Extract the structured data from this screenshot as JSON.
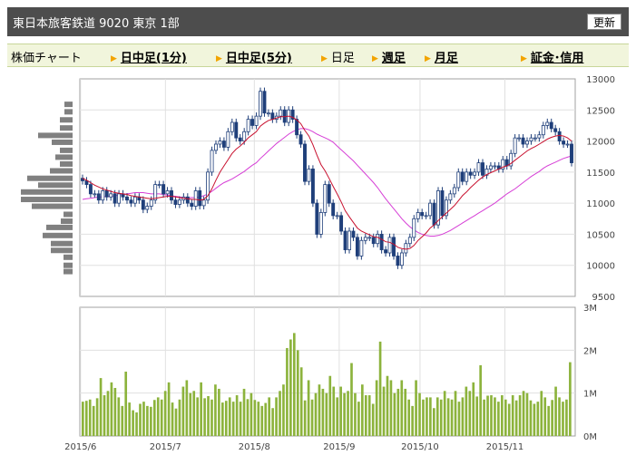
{
  "header": {
    "title": "東日本旅客鉄道  9020  東京 1部",
    "refresh_label": "更新"
  },
  "nav": {
    "chart_label": "株価チャート",
    "intraday1_label": "日中足(1分)",
    "intraday5_label": "日中足(5分)",
    "daily_label": "日足",
    "weekly_label": "週足",
    "monthly_label": "月足",
    "margin_label": "証金･信用"
  },
  "colors": {
    "up_candle": "#ffffff",
    "down_candle": "#1f3f7a",
    "ma_short": "#c8102e",
    "ma_long": "#d63fd6",
    "volume": "#8cb33c",
    "price_hist": "#808080"
  },
  "chart_data": {
    "type": "candlestick",
    "price_axis": {
      "min": 9500,
      "max": 13000,
      "ticks": [
        "13000",
        "12500",
        "12000",
        "11500",
        "11000",
        "10500",
        "10000",
        "9500"
      ]
    },
    "volume_axis": {
      "min": 0,
      "max": 3000000,
      "ticks": [
        "3M",
        "2M",
        "1M",
        "0M"
      ]
    },
    "x_labels": [
      "2015/6",
      "2015/7",
      "2015/8",
      "2015/9",
      "2015/10",
      "2015/11"
    ],
    "month_start_index": [
      0,
      21,
      43,
      64,
      84,
      105
    ],
    "close": [
      11360,
      11300,
      11150,
      11150,
      11050,
      11200,
      11100,
      11150,
      11000,
      11150,
      11100,
      11050,
      11000,
      11100,
      11050,
      10900,
      10950,
      11050,
      11300,
      11300,
      11150,
      11200,
      11050,
      10980,
      11050,
      11100,
      11000,
      10950,
      11200,
      10960,
      11050,
      11500,
      11850,
      11950,
      12000,
      11900,
      12150,
      12300,
      12050,
      12000,
      12150,
      12350,
      12250,
      12400,
      12800,
      12450,
      12450,
      12350,
      12400,
      12500,
      12300,
      12500,
      12350,
      12100,
      11950,
      11350,
      11550,
      11000,
      10500,
      10850,
      11300,
      11000,
      10800,
      10800,
      10550,
      10250,
      10550,
      10450,
      10150,
      10400,
      10450,
      10450,
      10350,
      10500,
      10250,
      10200,
      10450,
      10150,
      10000,
      10200,
      10350,
      10450,
      10750,
      10850,
      10800,
      10800,
      11000,
      10650,
      11200,
      10800,
      11050,
      11150,
      11250,
      11500,
      11350,
      11500,
      11450,
      11500,
      11650,
      11450,
      11550,
      11600,
      11600,
      11550,
      11700,
      11600,
      11800,
      12050,
      12050,
      11950,
      12000,
      12050,
      12050,
      12100,
      12250,
      12300,
      12200,
      12150,
      12000,
      11950,
      11950,
      11650
    ],
    "ma_short": [
      11400,
      11370,
      11330,
      11290,
      11260,
      11230,
      11210,
      11190,
      11170,
      11160,
      11150,
      11140,
      11120,
      11110,
      11100,
      11090,
      11080,
      11070,
      11080,
      11090,
      11100,
      11110,
      11110,
      11100,
      11090,
      11080,
      11070,
      11060,
      11060,
      11050,
      11060,
      11120,
      11230,
      11370,
      11500,
      11600,
      11700,
      11800,
      11870,
      11920,
      11980,
      12050,
      12100,
      12150,
      12240,
      12290,
      12330,
      12350,
      12370,
      12390,
      12390,
      12400,
      12380,
      12340,
      12280,
      12170,
      12080,
      11940,
      11770,
      11620,
      11520,
      11400,
      11270,
      11150,
      11020,
      10880,
      10780,
      10690,
      10600,
      10550,
      10520,
      10490,
      10460,
      10450,
      10420,
      10380,
      10370,
      10340,
      10290,
      10270,
      10260,
      10270,
      10320,
      10400,
      10460,
      10520,
      10600,
      10650,
      10720,
      10780,
      10840,
      10900,
      10960,
      11040,
      11120,
      11180,
      11250,
      11310,
      11370,
      11420,
      11460,
      11490,
      11520,
      11550,
      11580,
      11600,
      11640,
      11690,
      11740,
      11790,
      11840,
      11880,
      11910,
      11950,
      11990,
      12030,
      12060,
      12080,
      12090,
      12080,
      12050,
      12000
    ],
    "ma_long": [
      11060,
      11070,
      11080,
      11090,
      11100,
      11100,
      11110,
      11110,
      11120,
      11130,
      11140,
      11150,
      11160,
      11170,
      11170,
      11170,
      11160,
      11150,
      11150,
      11150,
      11140,
      11130,
      11120,
      11110,
      11100,
      11090,
      11090,
      11090,
      11090,
      11100,
      11120,
      11150,
      11190,
      11240,
      11290,
      11330,
      11360,
      11390,
      11430,
      11470,
      11510,
      11560,
      11610,
      11650,
      11720,
      11780,
      11840,
      11900,
      11960,
      12010,
      12060,
      12110,
      12150,
      12180,
      12200,
      12200,
      12180,
      12150,
      12110,
      12080,
      12050,
      12020,
      11980,
      11920,
      11860,
      11800,
      11740,
      11680,
      11610,
      11540,
      11470,
      11400,
      11330,
      11250,
      11160,
      11070,
      10990,
      10910,
      10830,
      10750,
      10680,
      10620,
      10570,
      10530,
      10500,
      10480,
      10470,
      10470,
      10480,
      10500,
      10530,
      10560,
      10600,
      10640,
      10680,
      10720,
      10760,
      10800,
      10840,
      10880,
      10920,
      10960,
      11000,
      11050,
      11100,
      11150,
      11190,
      11230,
      11280,
      11330,
      11380,
      11430,
      11470,
      11510,
      11560,
      11600,
      11630,
      11660,
      11690,
      11720,
      11740,
      11760
    ],
    "volume": [
      800000,
      820000,
      850000,
      700000,
      880000,
      1350000,
      950000,
      1050000,
      1250000,
      1120000,
      900000,
      700000,
      1500000,
      780000,
      600000,
      550000,
      750000,
      800000,
      700000,
      680000,
      840000,
      900000,
      850000,
      1050000,
      1250000,
      780000,
      640000,
      850000,
      1150000,
      1300000,
      1000000,
      1050000,
      900000,
      1250000,
      880000,
      930000,
      850000,
      1200000,
      1100000,
      780000,
      820000,
      900000,
      800000,
      950000,
      800000,
      1100000,
      860000,
      1000000,
      840000,
      800000,
      700000,
      770000,
      900000,
      650000,
      900000,
      1050000,
      1200000,
      2050000,
      2250000,
      2400000,
      2000000,
      1600000,
      830000,
      1300000,
      850000,
      1000000,
      1200000,
      1100000,
      1000000,
      1400000,
      1150000,
      900000,
      1150000,
      1000000,
      1050000,
      1700000,
      1000000,
      800000,
      1200000,
      950000,
      950000,
      750000,
      1300000,
      2200000,
      1150000,
      1400000,
      1300000,
      1000000,
      1100000,
      1300000,
      1100000,
      850000,
      700000,
      1300000,
      1000000,
      850000,
      900000,
      900000,
      650000,
      900000,
      850000,
      1050000,
      880000,
      850000,
      1050000,
      800000,
      900000,
      1150000,
      1050000,
      1250000,
      920000,
      1650000,
      850000,
      940000,
      950000,
      900000,
      800000,
      950000,
      850000,
      750000,
      950000,
      830000,
      950000,
      1050000,
      1000000,
      830000,
      750000,
      800000,
      1050000,
      900000,
      700000,
      840000,
      1150000,
      900000,
      800000,
      850000,
      1720000
    ],
    "price_histogram": [
      {
        "price": 12590,
        "width": 9
      },
      {
        "price": 12470,
        "width": 9
      },
      {
        "price": 12340,
        "width": 14
      },
      {
        "price": 12210,
        "width": 14
      },
      {
        "price": 12090,
        "width": 38
      },
      {
        "price": 11980,
        "width": 23
      },
      {
        "price": 11850,
        "width": 14
      },
      {
        "price": 11740,
        "width": 19
      },
      {
        "price": 11630,
        "width": 14
      },
      {
        "price": 11520,
        "width": 25
      },
      {
        "price": 11400,
        "width": 50
      },
      {
        "price": 11290,
        "width": 38
      },
      {
        "price": 11180,
        "width": 57
      },
      {
        "price": 11060,
        "width": 57
      },
      {
        "price": 10950,
        "width": 45
      },
      {
        "price": 10820,
        "width": 10
      },
      {
        "price": 10710,
        "width": 13
      },
      {
        "price": 10610,
        "width": 29
      },
      {
        "price": 10480,
        "width": 33
      },
      {
        "price": 10350,
        "width": 24
      },
      {
        "price": 10240,
        "width": 24
      },
      {
        "price": 10130,
        "width": 10
      },
      {
        "price": 10000,
        "width": 10
      },
      {
        "price": 9900,
        "width": 10
      }
    ]
  }
}
